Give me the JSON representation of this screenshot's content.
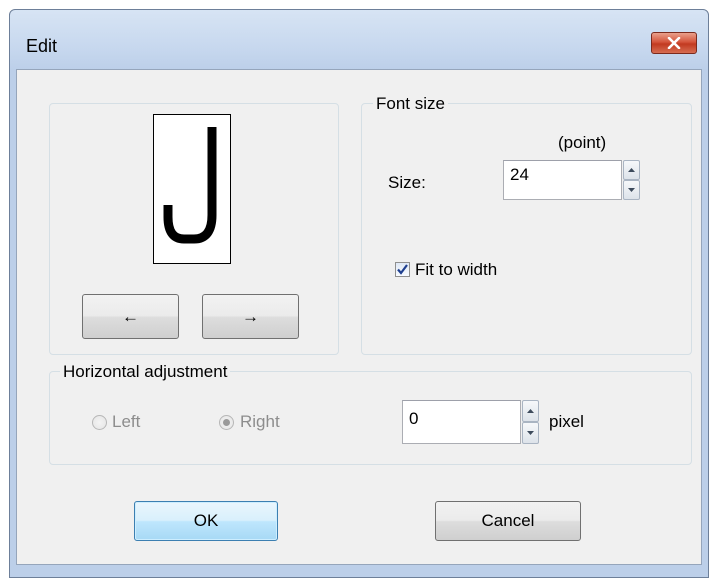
{
  "window": {
    "title": "Edit",
    "close_icon": "close-icon"
  },
  "preview": {
    "glyph": "J",
    "prev_label": "←",
    "next_label": "→"
  },
  "font_size": {
    "group_label": "Font size",
    "unit_label": "(point)",
    "size_label": "Size:",
    "size_value": "24",
    "fit_to_width_label": "Fit to width",
    "fit_to_width_checked": true
  },
  "horizontal_adjustment": {
    "group_label": "Horizontal adjustment",
    "left_label": "Left",
    "right_label": "Right",
    "selected": "Right",
    "offset_value": "0",
    "unit_label": "pixel"
  },
  "footer": {
    "ok_label": "OK",
    "cancel_label": "Cancel"
  },
  "colors": {
    "title_bar": "#c6d7ee",
    "close_button": "#c94b31",
    "dialog_background": "#f0f0f0",
    "default_button_accent": "#3c7fb1"
  }
}
